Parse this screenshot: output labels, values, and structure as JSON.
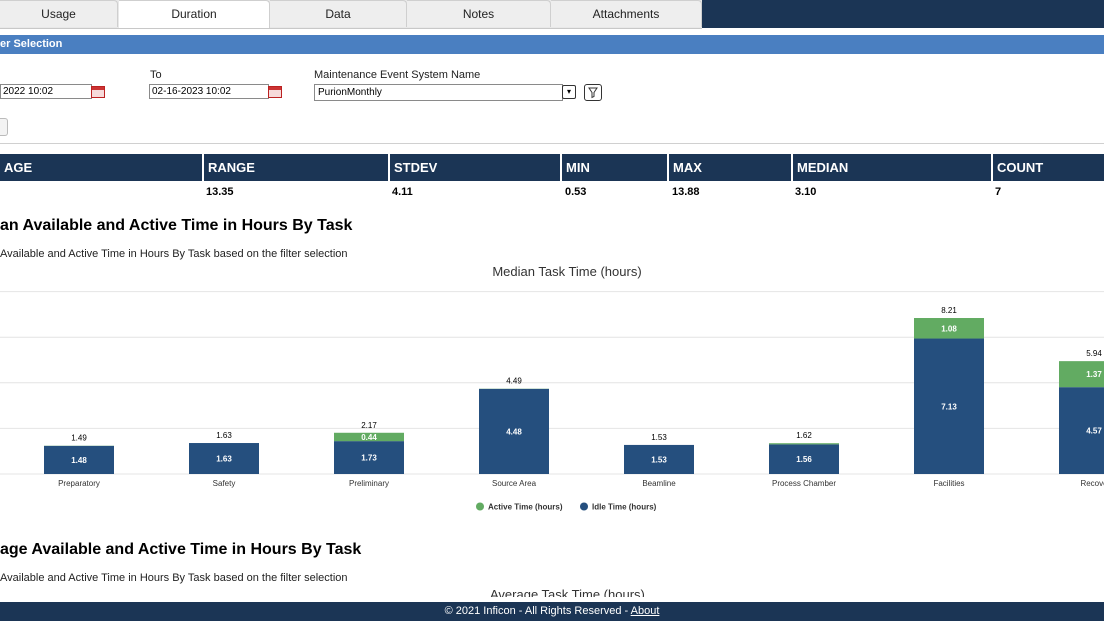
{
  "tabs": [
    {
      "label": "Usage",
      "active": false
    },
    {
      "label": "Duration",
      "active": true
    },
    {
      "label": "Data",
      "active": false
    },
    {
      "label": "Notes",
      "active": false
    },
    {
      "label": "Attachments",
      "active": false
    }
  ],
  "filter": {
    "header": "er Selection",
    "from_value": "2022 10:02",
    "to_label": "To",
    "to_value": "02-16-2023 10:02",
    "system_label": "Maintenance Event System Name",
    "system_value": "PurionMonthly"
  },
  "stats": {
    "headers": [
      "AGE",
      "RANGE",
      "STDEV",
      "MIN",
      "MAX",
      "MEDIAN",
      "COUNT"
    ],
    "values": [
      "",
      "13.35",
      "4.11",
      "0.53",
      "13.88",
      "3.10",
      "7"
    ]
  },
  "section1": {
    "title": "an Available and Active Time in Hours By Task",
    "subtitle": "Available and Active Time in Hours By Task based on the filter selection"
  },
  "section2": {
    "title": "age Available and Active Time in Hours By Task",
    "subtitle": " Available and Active Time in Hours By Task based on the filter selection",
    "chart_title_partial": "Average Task Time (hours)"
  },
  "chart_data": {
    "type": "bar",
    "stacked": true,
    "title": "Median Task Time (hours)",
    "categories": [
      "Preparatory",
      "Safety",
      "Preliminary",
      "Source Area",
      "Beamline",
      "Process Chamber",
      "Facilities",
      "Recove"
    ],
    "series": [
      {
        "name": "Idle Time (hours)",
        "color": "#254f7e",
        "values": [
          1.48,
          1.63,
          1.73,
          4.48,
          1.53,
          1.56,
          7.13,
          4.57
        ]
      },
      {
        "name": "Active Time (hours)",
        "color": "#62ab62",
        "values": [
          0.01,
          0.0,
          0.44,
          0.01,
          0.0,
          0.06,
          1.08,
          1.37
        ]
      }
    ],
    "segment_labels": {
      "idle": [
        "1.48",
        "1.63",
        "1.73",
        "4.48",
        "1.53",
        "1.56",
        "7.13",
        "4.57"
      ],
      "active": [
        "",
        "",
        "0.44",
        "",
        "",
        "",
        "1.08",
        "1.37"
      ]
    },
    "totals": [
      "1.49",
      "1.63",
      "2.17",
      "4.49",
      "1.53",
      "1.62",
      "8.21",
      "5.94"
    ],
    "ylim": [
      0,
      8.5
    ],
    "grid": true,
    "legend": "bottom"
  },
  "footer": {
    "text": "© 2021 Inficon - All Rights Reserved - ",
    "link": "About"
  },
  "colors": {
    "navy": "#1b3555",
    "filter_bar": "#4a7fc1",
    "active": "#62ab62",
    "idle": "#254f7e"
  }
}
